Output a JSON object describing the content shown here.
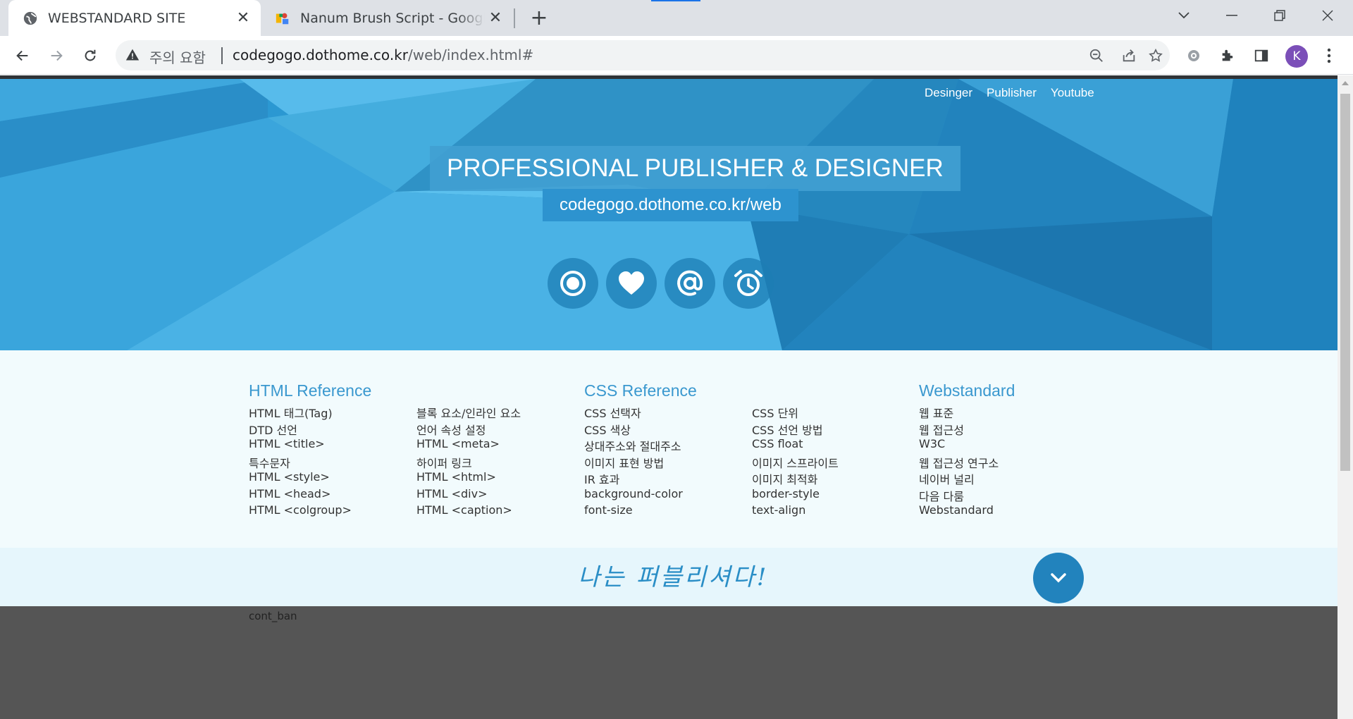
{
  "browser": {
    "tabs": [
      {
        "title": "WEBSTANDARD SITE",
        "active": true
      },
      {
        "title": "Nanum Brush Script - Google Fonts",
        "active": false
      }
    ],
    "security_label": "주의 요함",
    "url_host": "codegogo.dothome.co.kr",
    "url_path": "/web/index.html#",
    "profile_initial": "K"
  },
  "page": {
    "nav": [
      "Desinger",
      "Publisher",
      "Youtube"
    ],
    "headline": "PROFESSIONAL PUBLISHER & DESIGNER",
    "subline": "codegogo.dothome.co.kr/web",
    "icons": [
      "record-icon",
      "heart-icon",
      "at-icon",
      "alarm-clock-icon"
    ],
    "sections": [
      {
        "title": "HTML Reference",
        "col1": [
          "HTML 태그(Tag)",
          "DTD 선언",
          "HTML <title>",
          "특수문자",
          "HTML <style>",
          "HTML <head>",
          "HTML <colgroup>"
        ],
        "col2": [
          "블록 요소/인라인 요소",
          "언어 속성 설정",
          "HTML <meta>",
          "하이퍼 링크",
          "HTML <html>",
          "HTML <div>",
          "HTML <caption>"
        ]
      },
      {
        "title": "CSS Reference",
        "col1": [
          "CSS 선택자",
          "CSS 색상",
          "상대주소와 절대주소",
          "이미지 표현 방법",
          "IR 효과",
          "background-color",
          "font-size"
        ],
        "col2": [
          "CSS 단위",
          "CSS 선언 방법",
          "CSS float",
          "이미지 스프라이트",
          "이미지 최적화",
          "border-style",
          "text-align"
        ]
      },
      {
        "title": "Webstandard",
        "col1": [
          "웹 표준",
          "웹 접근성",
          "W3C",
          "웹 접근성 연구소",
          "네이버 널리",
          "다음 다룸",
          "Webstandard"
        ]
      }
    ],
    "slogan": "나는 퍼블리셔다!",
    "cont_ban": "cont_ban"
  },
  "colors": {
    "accent": "#3a98cf",
    "banner_button": "#2283bd",
    "dark_area": "#555555"
  }
}
